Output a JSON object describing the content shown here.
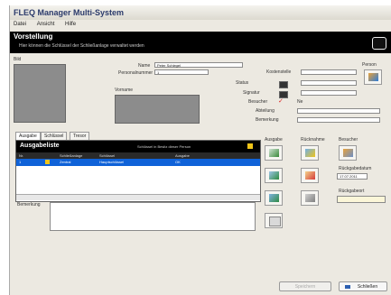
{
  "window": {
    "title": "FLEQ Manager Multi-System"
  },
  "menu": [
    "Datei",
    "Ansicht",
    "Hilfe"
  ],
  "header": {
    "title": "Vorstellung",
    "subtitle": "Hier können die Schlüssel der Schließanlage verwaltet werden"
  },
  "person": {
    "bild_label": "Bild",
    "name_label": "Name",
    "name_value": "Peter Schlegel",
    "pnr_label": "Personalnummer",
    "pnr_value": "1",
    "vorname_label": "Vorname",
    "kostenstelle_label": "Kostenstelle",
    "status_label": "Status",
    "signatur_label": "Signatur",
    "gruppe_label": "Gruppe",
    "besucher_label": "Besucher",
    "besucher_value": "Ne",
    "abteilung_label": "Abteilung",
    "bemerkung_label": "Bemerkung",
    "person_btn_label": "Person"
  },
  "tabs": [
    "Ausgabe",
    "Schlüssel",
    "Tresor"
  ],
  "grid": {
    "title": "Ausgabeliste",
    "info": "Schlüssel in Besitz dieser Person",
    "columns": [
      "Nr.",
      "Schließanlage",
      "Schlüssel",
      "Ausgabe"
    ],
    "rows": [
      {
        "c0": "1",
        "c1": "Zentral",
        "c2": "Hauptschlüssel",
        "c3": "OK"
      }
    ]
  },
  "side": {
    "ausgabe_label": "Ausgabe",
    "ruecknahme_label": "Rücknahme",
    "besucher_label": "Besucher",
    "rueckgabedatum_label": "Rückgabedatum",
    "rueckgabedatum_value": "17.07.2011",
    "rueckgabeort_label": "Rückgabeort"
  },
  "memo": {
    "label": "Bemerkung"
  },
  "buttons": {
    "speichern": "Speichern",
    "schliessen": "Schließen"
  },
  "colors": {
    "header": "#000000",
    "selection": "#0f62d8",
    "accent": "#f0c419"
  }
}
